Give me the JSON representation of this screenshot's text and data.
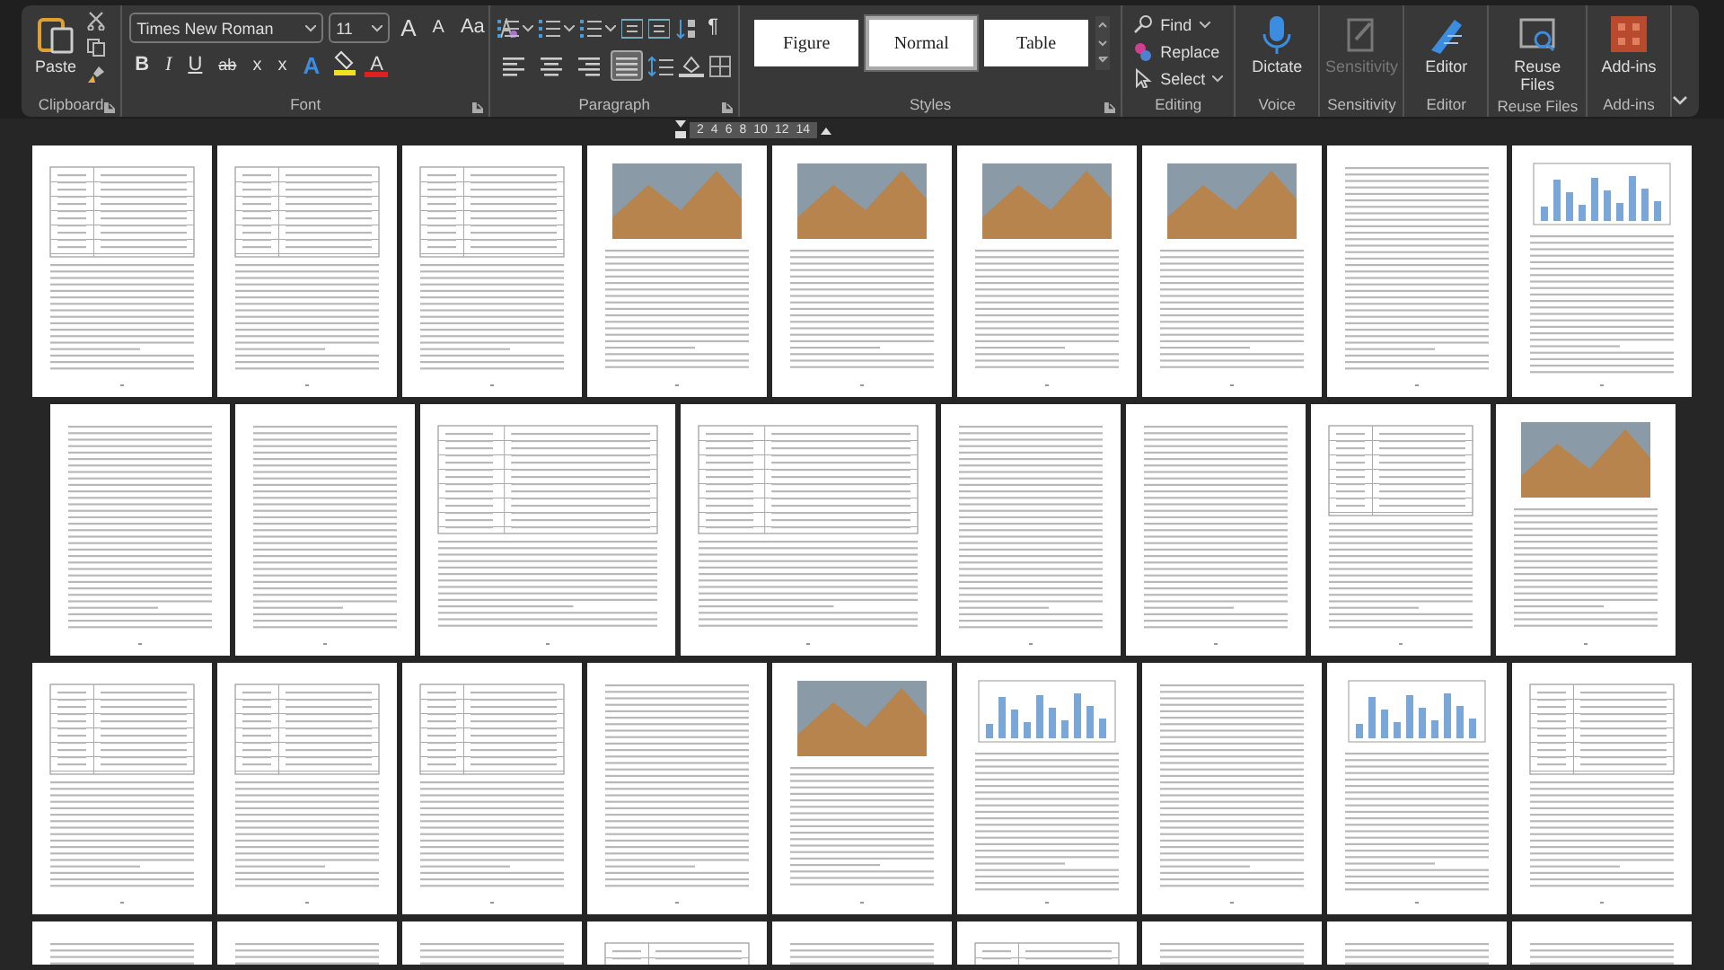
{
  "ribbon": {
    "clipboard": {
      "group": "Clipboard",
      "paste": "Paste"
    },
    "font": {
      "group": "Font",
      "name": "Times New Roman",
      "size": "11",
      "buttons": [
        {
          "label": "A",
          "kind": "grow"
        },
        {
          "label": "A",
          "kind": "shrink"
        },
        {
          "label": "Aa",
          "kind": "case"
        },
        {
          "label": "B",
          "kind": "bold"
        },
        {
          "label": "I",
          "kind": "italic"
        },
        {
          "label": "U",
          "kind": "underline"
        },
        {
          "label": "ab",
          "kind": "strike"
        },
        {
          "label": "x",
          "kind": "sub"
        },
        {
          "label": "x",
          "kind": "sup"
        },
        {
          "label": "A",
          "kind": "effects"
        },
        {
          "kind": "highlight"
        },
        {
          "label": "A",
          "kind": "color"
        }
      ]
    },
    "paragraph": {
      "group": "Paragraph",
      "marks": "¶",
      "alignments": [
        {
          "kind": "left",
          "selected": false
        },
        {
          "kind": "center",
          "selected": false
        },
        {
          "kind": "right",
          "selected": false
        },
        {
          "kind": "justify",
          "selected": true
        }
      ]
    },
    "styles": {
      "group": "Styles",
      "items": [
        {
          "label": "Figure",
          "selected": false
        },
        {
          "label": "Normal",
          "selected": true
        },
        {
          "label": "Table",
          "selected": false
        }
      ]
    },
    "editing": {
      "group": "Editing",
      "items": [
        {
          "label": "Find",
          "kind": "find"
        },
        {
          "label": "Replace",
          "kind": "replace"
        },
        {
          "label": "Select",
          "kind": "select"
        }
      ]
    },
    "big_groups": [
      {
        "group": "Voice",
        "label": "Dictate",
        "kind": "mic",
        "disabled": false
      },
      {
        "group": "Sensitivity",
        "label": "Sensitivity",
        "kind": "sensitivity",
        "disabled": true
      },
      {
        "group": "Editor",
        "label": "Editor",
        "kind": "editor",
        "disabled": false
      },
      {
        "group": "Reuse Files",
        "label": "Reuse Files",
        "kind": "reuse",
        "disabled": false
      },
      {
        "group": "Add-ins",
        "label": "Add-ins",
        "kind": "addins",
        "disabled": false
      }
    ]
  },
  "ruler": {
    "ticks": [
      "2",
      "4",
      "6",
      "8",
      "10",
      "12",
      "14"
    ]
  },
  "pages": [
    [
      {
        "kind": "table"
      },
      {
        "kind": "table"
      },
      {
        "kind": "table"
      },
      {
        "kind": "figure"
      },
      {
        "kind": "figure"
      },
      {
        "kind": "figure"
      },
      {
        "kind": "figure"
      },
      {
        "kind": "text"
      },
      {
        "kind": "chart"
      }
    ],
    [
      {
        "kind": "text"
      },
      {
        "kind": "text"
      },
      {
        "kind": "landscape"
      },
      {
        "kind": "landscape"
      },
      {
        "kind": "text"
      },
      {
        "kind": "text"
      },
      {
        "kind": "table"
      },
      {
        "kind": "figure"
      }
    ],
    [
      {
        "kind": "table"
      },
      {
        "kind": "table"
      },
      {
        "kind": "table"
      },
      {
        "kind": "text"
      },
      {
        "kind": "figure"
      },
      {
        "kind": "chart"
      },
      {
        "kind": "text"
      },
      {
        "kind": "chart"
      },
      {
        "kind": "table"
      }
    ],
    [
      {
        "kind": "text"
      },
      {
        "kind": "text"
      },
      {
        "kind": "text"
      },
      {
        "kind": "table"
      },
      {
        "kind": "text"
      },
      {
        "kind": "table"
      },
      {
        "kind": "text"
      },
      {
        "kind": "text"
      },
      {
        "kind": "text"
      }
    ]
  ]
}
